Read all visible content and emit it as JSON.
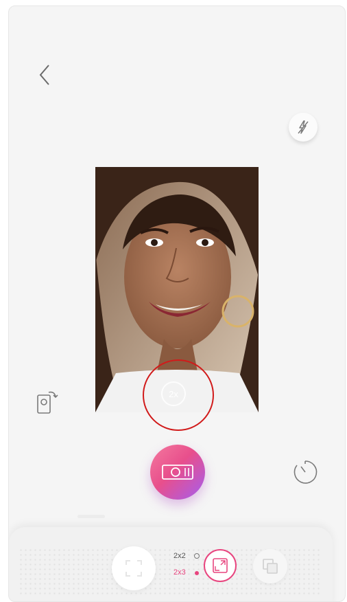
{
  "camera": {
    "zoom_label": "2x"
  },
  "print_size": {
    "option_2x2": "2x2",
    "option_2x3": "2x3",
    "selected": "2x3"
  },
  "icons": {
    "back": "chevron-left-icon",
    "flash": "flash-off-icon",
    "rotate": "switch-camera-icon",
    "shutter": "camera-icon",
    "timer": "timer-icon",
    "full_mode": "frame-full-icon",
    "fit_mode": "frame-fit-icon",
    "collage_mode": "collage-icon"
  },
  "colors": {
    "accent": "#e8457f",
    "highlight_ring": "#d11a1a"
  }
}
